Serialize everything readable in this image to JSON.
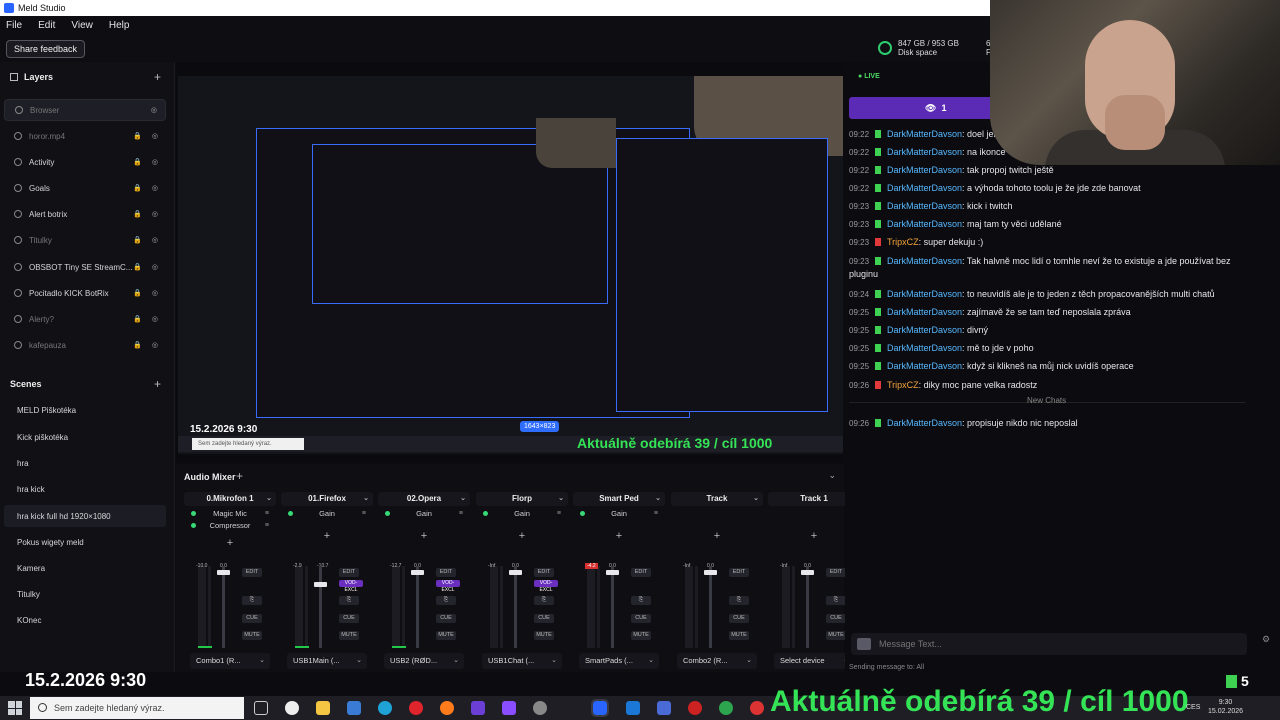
{
  "window": {
    "title": "Meld Studio"
  },
  "menu": [
    "File",
    "Edit",
    "View",
    "Help"
  ],
  "toolbar": {
    "share_label": "Share feedback",
    "disk_value": "847 GB / 953 GB",
    "disk_label": "Disk space",
    "fps_value": "60.",
    "fps_label": "FP"
  },
  "layers": {
    "title": "Layers",
    "items": [
      {
        "label": "Browser"
      },
      {
        "label": "horor.mp4"
      },
      {
        "label": "Activity"
      },
      {
        "label": "Goals"
      },
      {
        "label": "Alert botrix"
      },
      {
        "label": "Titulky"
      },
      {
        "label": "OBSBOT Tiny SE StreamC..."
      },
      {
        "label": "Pocitadlo KICK BotRix"
      },
      {
        "label": "Alerty?"
      },
      {
        "label": "kafepauza"
      }
    ]
  },
  "scenes": {
    "title": "Scenes",
    "items": [
      {
        "label": "MELD Piškotéka"
      },
      {
        "label": "Kick piškotéka"
      },
      {
        "label": "hra"
      },
      {
        "label": "hra kick"
      },
      {
        "label": "hra kick full hd 1920×1080"
      },
      {
        "label": "Pokus wigety meld"
      },
      {
        "label": "Kamera"
      },
      {
        "label": "Titulky"
      },
      {
        "label": "KOnec"
      }
    ]
  },
  "preview": {
    "date": "15.2.2026 9:30",
    "subs": "Aktuálně odebírá 39 / cíl 1000",
    "size": "1643×823",
    "search": "Sem zadejte hledaný výraz."
  },
  "mixer": {
    "title": "Audio Mixer",
    "add_label": "+",
    "edit_label": "EDIT",
    "cue_label": "CUE",
    "mute_label": "MUTE",
    "vod_label": "VOD-EXCL",
    "channels": [
      {
        "name": "0.Mikrofon 1",
        "fx": [
          "Magic Mic",
          "Compressor"
        ],
        "db_left": "-10.0",
        "db_right": "0.0",
        "device": "Combo1 (R...",
        "fader": 0.95,
        "vod": false,
        "clip": false
      },
      {
        "name": "01.Firefox",
        "fx": [
          "Gain"
        ],
        "db_left": "-2.9",
        "db_right": "-10.7",
        "device": "USB1Main (...",
        "fader": 0.8,
        "vod": true,
        "clip": false
      },
      {
        "name": "02.Opera",
        "fx": [
          "Gain"
        ],
        "db_left": "-12.7",
        "db_right": "0.0",
        "device": "USB2 (RØD...",
        "fader": 0.95,
        "vod": true,
        "clip": false
      },
      {
        "name": "Florp",
        "fx": [
          "Gain"
        ],
        "db_left": "-Inf",
        "db_right": "0.0",
        "device": "USB1Chat (...",
        "fader": 0.95,
        "vod": true,
        "clip": false
      },
      {
        "name": "Smart Ped",
        "fx": [
          "Gain"
        ],
        "db_left": "-4.2",
        "db_right": "0.0",
        "device": "SmartPads (...",
        "fader": 0.95,
        "vod": false,
        "clip": true
      },
      {
        "name": "Track",
        "fx": [],
        "db_left": "-Inf",
        "db_right": "0.0",
        "device": "Combo2 (R...",
        "fader": 0.95,
        "vod": false,
        "clip": false
      },
      {
        "name": "Track 1",
        "fx": [],
        "db_left": "-Inf",
        "db_right": "0.0",
        "device": "Select device",
        "fader": 0.95,
        "vod": false,
        "clip": false
      }
    ]
  },
  "chat": {
    "live_label": "LIVE",
    "viewers": "1",
    "messages": [
      {
        "time": "09:22",
        "platform": "kick",
        "user": "DarkMatterDavson",
        "text": ": doel jen p"
      },
      {
        "time": "09:22",
        "platform": "kick",
        "user": "DarkMatterDavson",
        "text": ": na ikonce"
      },
      {
        "time": "09:22",
        "platform": "kick",
        "user": "DarkMatterDavson",
        "text": ": tak propoj twitch ještě"
      },
      {
        "time": "09:22",
        "platform": "kick",
        "user": "DarkMatterDavson",
        "text": ": a výhoda tohoto toolu je že jde zde banovat"
      },
      {
        "time": "09:23",
        "platform": "kick",
        "user": "DarkMatterDavson",
        "text": ": kick i twitch"
      },
      {
        "time": "09:23",
        "platform": "kick",
        "user": "DarkMatterDavson",
        "text": ": maj tam ty věci udělané"
      },
      {
        "time": "09:23",
        "platform": "twitch",
        "user": "TripxCZ",
        "text": ": super dekuju :)"
      },
      {
        "time": "09:23",
        "platform": "kick",
        "user": "DarkMatterDavson",
        "text": ": Tak halvně moc lidí o tomhle neví že to existuje a jde používat bez pluginu"
      },
      {
        "time": "09:24",
        "platform": "kick",
        "user": "DarkMatterDavson",
        "text": ": to neuvidíš ale je to jeden z těch propacovanějších multi chatů"
      },
      {
        "time": "09:25",
        "platform": "kick",
        "user": "DarkMatterDavson",
        "text": ": zajímavě že se tam teď neposlala zpráva"
      },
      {
        "time": "09:25",
        "platform": "kick",
        "user": "DarkMatterDavson",
        "text": ": divný"
      },
      {
        "time": "09:25",
        "platform": "kick",
        "user": "DarkMatterDavson",
        "text": ": mě to jde v poho"
      },
      {
        "time": "09:25",
        "platform": "kick",
        "user": "DarkMatterDavson",
        "text": ": když si klikneš na můj nick uvidíš operace"
      },
      {
        "time": "09:26",
        "platform": "twitch",
        "user": "TripxCZ",
        "text": ": diky moc pane velka radostz"
      }
    ],
    "new_chats_label": "New Chats",
    "after": [
      {
        "time": "09:26",
        "platform": "kick",
        "user": "DarkMatterDavson",
        "text": ": propisuje nikdo nic neposlal"
      }
    ],
    "input_placeholder": "Message Text...",
    "sending_label": "Sending message to: All"
  },
  "overlay": {
    "date": "15.2.2026 9:30",
    "subs": "Aktuálně odebírá 39 / cíl 1000",
    "kick_count": "5"
  },
  "taskbar": {
    "search_placeholder": "Sem zadejte hledaný výraz.",
    "lang": "CES",
    "time": "9:30",
    "date": "15.02.2026"
  },
  "colors": {
    "accent": "#5b2bb5",
    "kick": "#3ed152",
    "twitch_user": "#f5a43a",
    "kick_user": "#57b8ff",
    "selection": "#2f6dff"
  }
}
